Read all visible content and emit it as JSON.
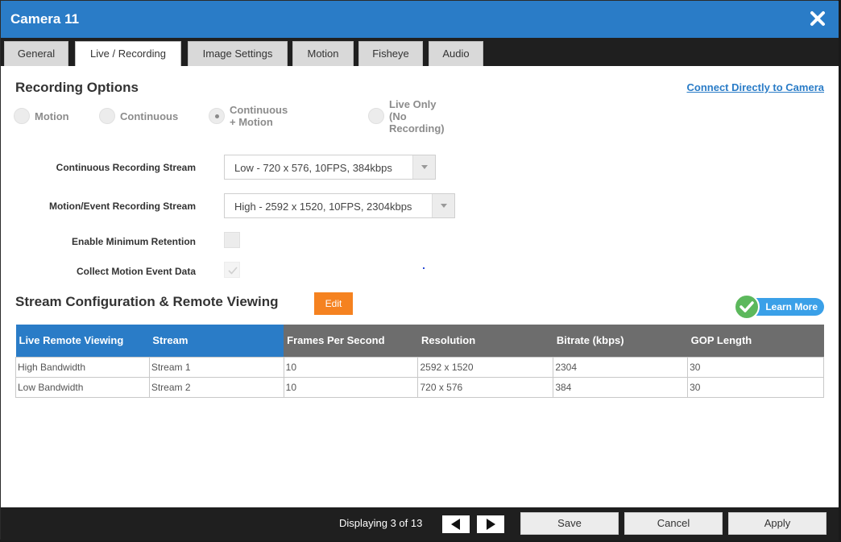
{
  "window": {
    "title": "Camera 11"
  },
  "tabs": [
    {
      "label": "General"
    },
    {
      "label": "Live / Recording"
    },
    {
      "label": "Image Settings"
    },
    {
      "label": "Motion"
    },
    {
      "label": "Fisheye"
    },
    {
      "label": "Audio"
    }
  ],
  "active_tab": "Live / Recording",
  "recording": {
    "title": "Recording Options",
    "connect_link": "Connect Directly to Camera",
    "options": [
      {
        "label": "Motion"
      },
      {
        "label": "Continuous"
      },
      {
        "label": "Continuous + Motion"
      },
      {
        "label": "Live Only (No Recording)"
      }
    ],
    "selected_option": "Continuous + Motion"
  },
  "fields": {
    "continuous_stream": {
      "label": "Continuous Recording Stream",
      "value": "Low - 720 x 576, 10FPS, 384kbps"
    },
    "motion_stream": {
      "label": "Motion/Event Recording Stream",
      "value": "High - 2592 x 1520, 10FPS, 2304kbps"
    },
    "min_retention": {
      "label": "Enable Minimum Retention",
      "checked": false
    },
    "motion_event_data": {
      "label": "Collect Motion Event Data",
      "checked": true
    }
  },
  "stream_config": {
    "title": "Stream Configuration & Remote Viewing",
    "edit_label": "Edit",
    "learn_more_label": "Learn More",
    "columns": [
      "Live Remote Viewing",
      "Stream",
      "Frames Per Second",
      "Resolution",
      "Bitrate (kbps)",
      "GOP Length"
    ],
    "rows": [
      [
        "High Bandwidth",
        "Stream 1",
        "10",
        "2592 x 1520",
        "2304",
        "30"
      ],
      [
        "Low Bandwidth",
        "Stream 2",
        "10",
        "720 x 576",
        "384",
        "30"
      ]
    ]
  },
  "footer": {
    "display_text": "Displaying 3 of 13",
    "save_label": "Save",
    "cancel_label": "Cancel",
    "apply_label": "Apply"
  },
  "colors": {
    "brand_blue": "#2a7cc7",
    "edit_orange": "#f58220",
    "success_green": "#5cb85c",
    "dark_bar": "#1f1f1f"
  }
}
